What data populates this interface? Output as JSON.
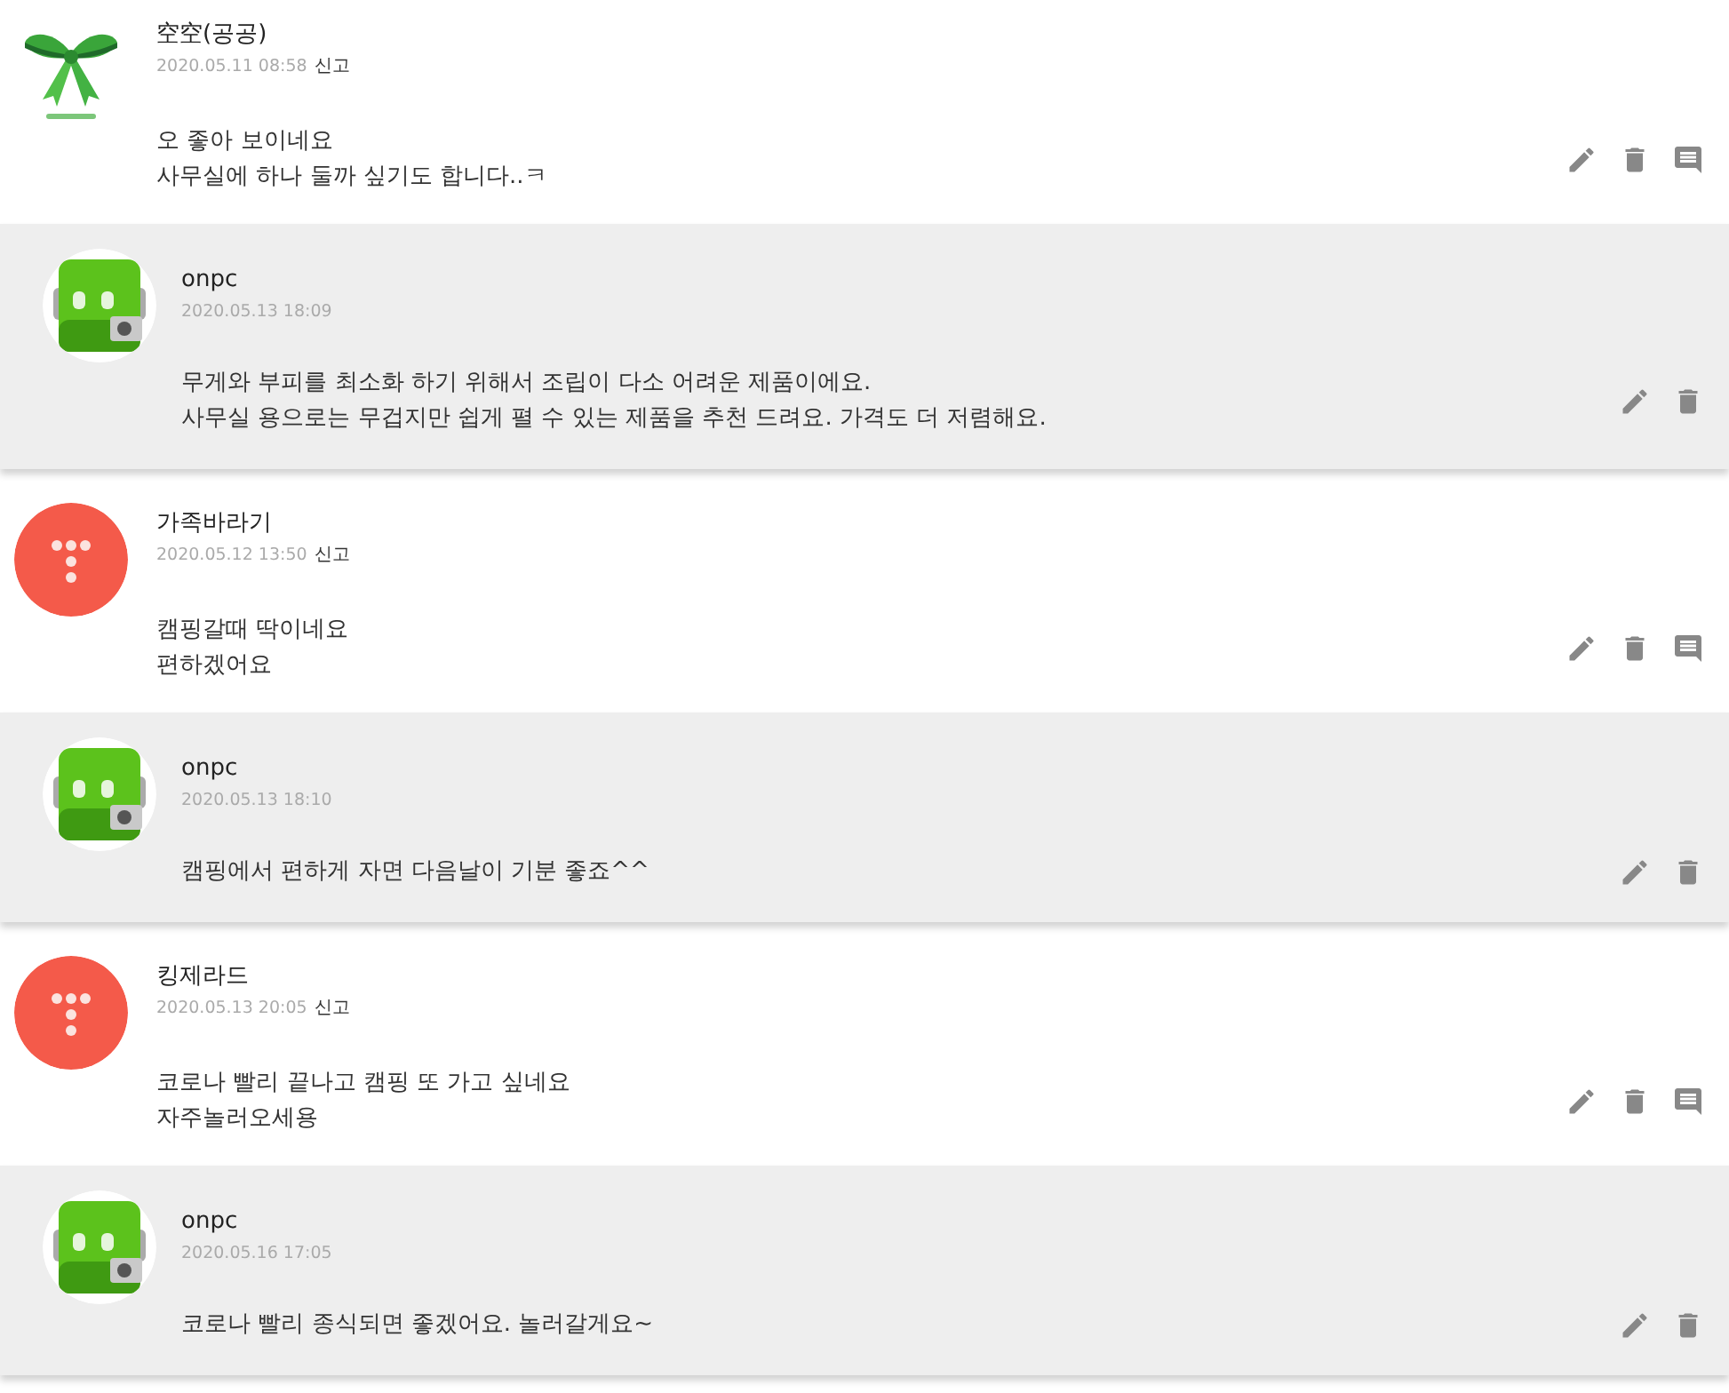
{
  "comments": [
    {
      "avatar": {
        "kind": "ribbon"
      },
      "author": "空空(공공)",
      "date": "2020.05.11 08:58",
      "report": "신고",
      "text": "오 좋아 보이네요\n사무실에 하나 둘까 싶기도 합니다..ㅋ",
      "reply": {
        "avatar": {
          "kind": "robot"
        },
        "author": "onpc",
        "date": "2020.05.13 18:09",
        "text": "무게와 부피를 최소화 하기 위해서 조립이 다소 어려운 제품이에요.\n사무실 용으로는 무겁지만 쉽게 펼 수 있는 제품을 추천 드려요. 가격도 더 저렴해요."
      }
    },
    {
      "avatar": {
        "kind": "dots"
      },
      "author": "가족바라기",
      "date": "2020.05.12 13:50",
      "report": "신고",
      "text": "캠핑갈때 딱이네요\n편하겠어요",
      "reply": {
        "avatar": {
          "kind": "robot"
        },
        "author": "onpc",
        "date": "2020.05.13 18:10",
        "text": "캠핑에서 편하게 자면 다음날이 기분 좋죠^^"
      }
    },
    {
      "avatar": {
        "kind": "dots"
      },
      "author": "킹제라드",
      "date": "2020.05.13 20:05",
      "report": "신고",
      "text": "코로나 빨리 끝나고 캠핑 또 가고 싶네요\n자주놀러오세용",
      "reply": {
        "avatar": {
          "kind": "robot"
        },
        "author": "onpc",
        "date": "2020.05.16 17:05",
        "text": "코로나 빨리 종식되면 좋겠어요. 놀러갈게요~"
      }
    }
  ]
}
